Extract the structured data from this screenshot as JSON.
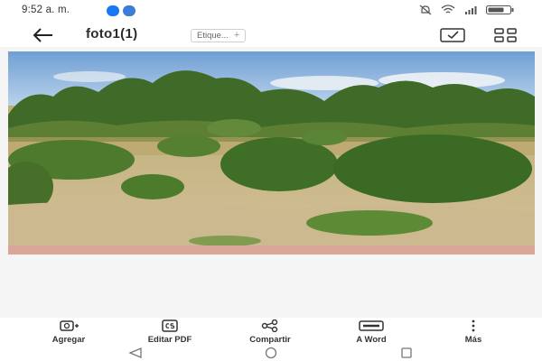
{
  "status_bar": {
    "time": "9:52 a. m.",
    "app_icons": [
      "facebook-icon",
      "messenger-icon"
    ],
    "right_icons": [
      "mute-icon",
      "wifi-icon",
      "signal-icon",
      "battery-icon"
    ],
    "app_colors": [
      "#1877f2",
      "#3b7dd8"
    ]
  },
  "header": {
    "title": "foto1(1)",
    "tag_placeholder": "Etique...",
    "tag_add": "+"
  },
  "toolbar": {
    "items": [
      {
        "label": "Agregar",
        "icon": "add-photo-icon"
      },
      {
        "label": "Editar PDF",
        "icon": "cs-pdf-icon"
      },
      {
        "label": "Compartir",
        "icon": "share-icon"
      },
      {
        "label": "A Word",
        "icon": "word-icon"
      },
      {
        "label": "Más",
        "icon": "more-vertical-icon"
      }
    ]
  },
  "navbar": {
    "buttons": [
      "back-triangle",
      "home-circle",
      "recents-square"
    ]
  },
  "colors": {
    "background": "#ffffff",
    "sky": "#8fb6dc",
    "field": "#c9b58a",
    "foliage": "#4e7a2e"
  }
}
